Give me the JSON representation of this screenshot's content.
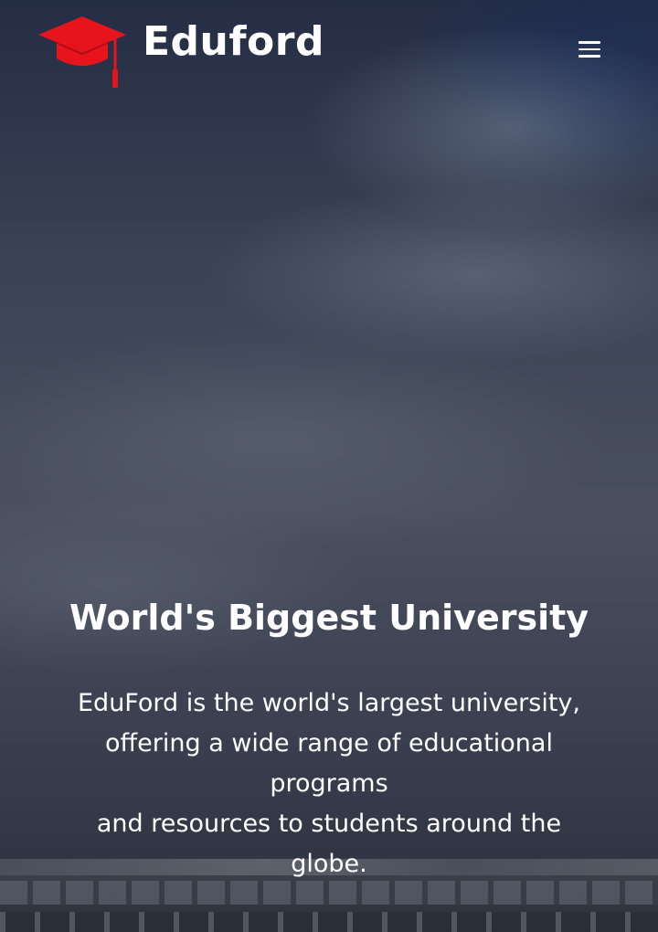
{
  "header": {
    "brand_name": "Eduford",
    "logo_icon": "graduation-cap-icon",
    "logo_color": "#e8141c",
    "menu_icon": "hamburger-menu-icon"
  },
  "hero": {
    "title": "World's Biggest University",
    "description_lines": [
      "EduFord is the world's largest university,",
      "offering a wide range of educational programs",
      "and resources to students around the globe."
    ]
  }
}
